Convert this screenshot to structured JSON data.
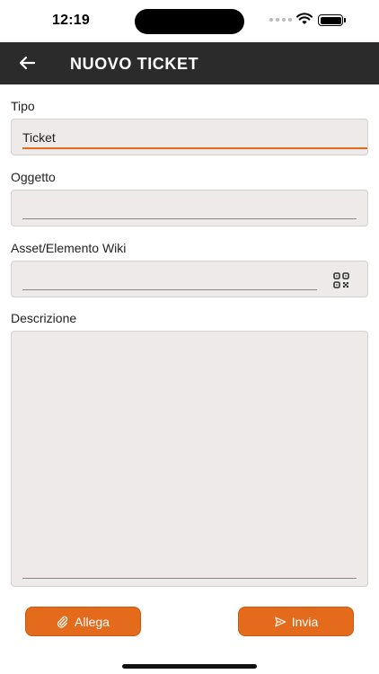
{
  "status_bar": {
    "time": "12:19"
  },
  "app_bar": {
    "title": "NUOVO TICKET"
  },
  "form": {
    "tipo": {
      "label": "Tipo",
      "value": "Ticket"
    },
    "oggetto": {
      "label": "Oggetto",
      "value": ""
    },
    "asset": {
      "label": "Asset/Elemento Wiki",
      "value": ""
    },
    "descrizione": {
      "label": "Descrizione",
      "value": ""
    }
  },
  "actions": {
    "attach_label": "Allega",
    "send_label": "Invia"
  },
  "colors": {
    "accent": "#e46a1c",
    "app_bar": "#2b2b2b",
    "field_bg": "#eeeaea"
  }
}
